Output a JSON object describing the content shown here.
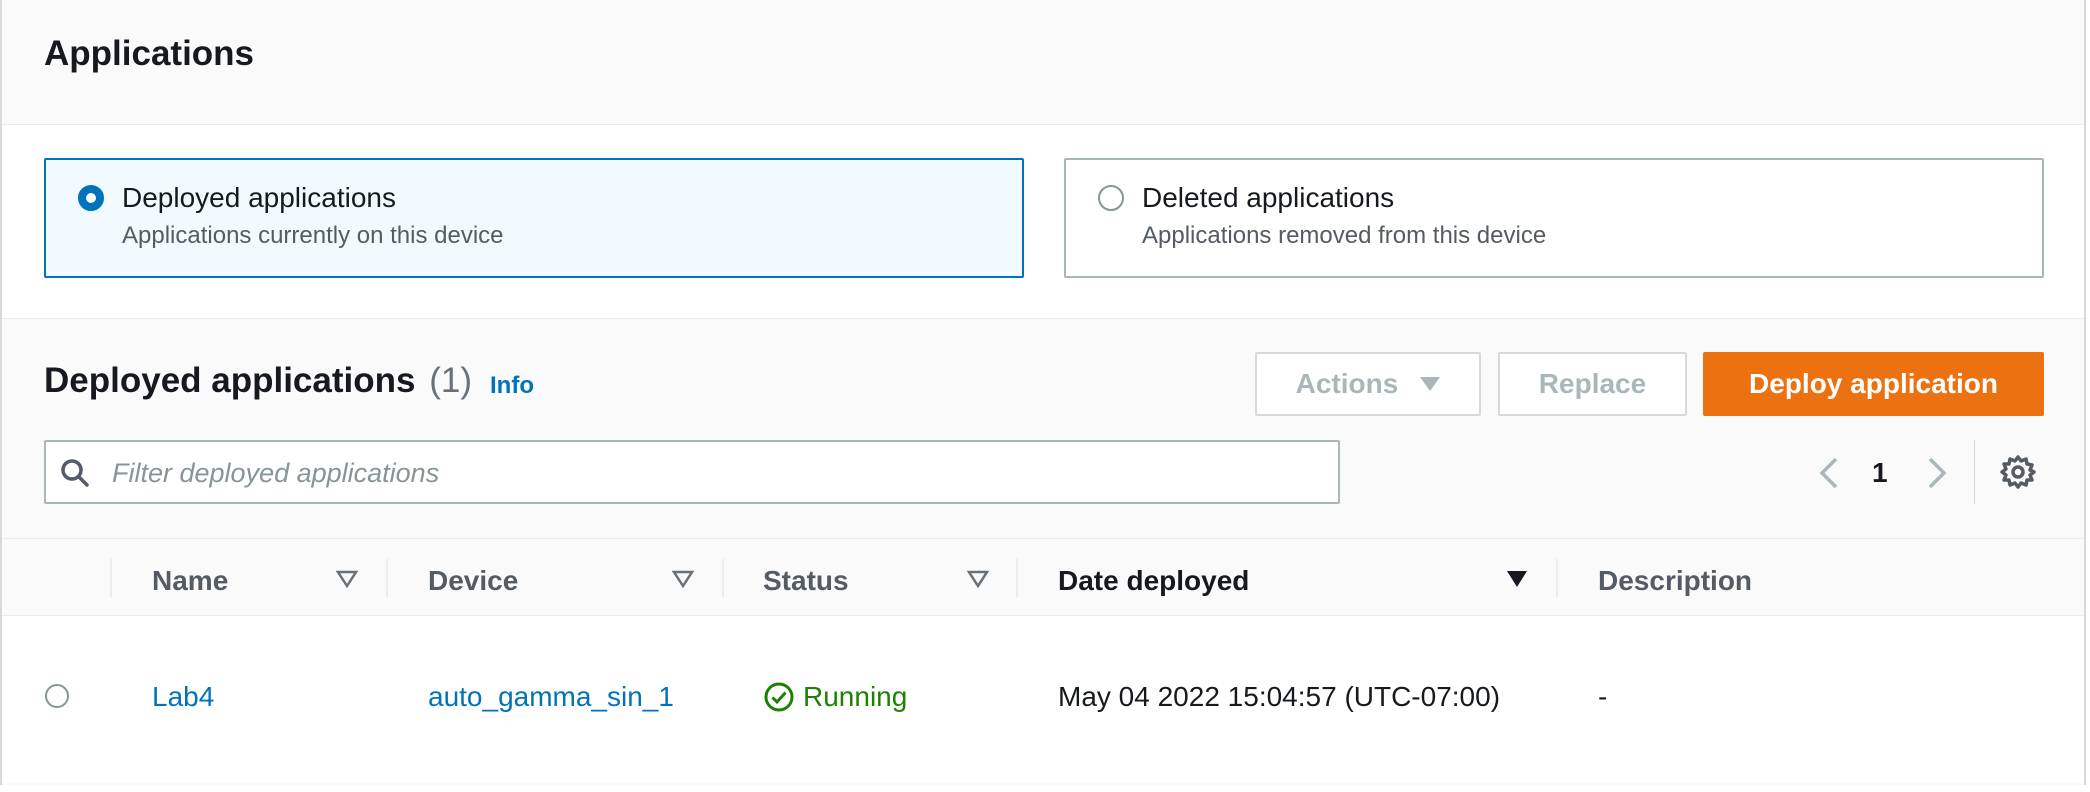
{
  "header": {
    "title": "Applications"
  },
  "tiles": [
    {
      "label": "Deployed applications",
      "description": "Applications currently on this device",
      "selected": true
    },
    {
      "label": "Deleted applications",
      "description": "Applications removed from this device",
      "selected": false
    }
  ],
  "section": {
    "title": "Deployed applications",
    "count": "(1)",
    "info": "Info",
    "actions_label": "Actions",
    "replace_label": "Replace",
    "deploy_label": "Deploy application",
    "search_placeholder": "Filter deployed applications",
    "page": "1"
  },
  "table": {
    "columns": [
      "Name",
      "Device",
      "Status",
      "Date deployed",
      "Description"
    ],
    "rows": [
      {
        "name": "Lab4",
        "device": "auto_gamma_sin_1",
        "status": "Running",
        "date": "May 04 2022 15:04:57 (UTC-07:00)",
        "description": "-"
      }
    ]
  },
  "colors": {
    "accent": "#0073bb",
    "primary_button": "#ec7211",
    "success": "#1d8102"
  }
}
